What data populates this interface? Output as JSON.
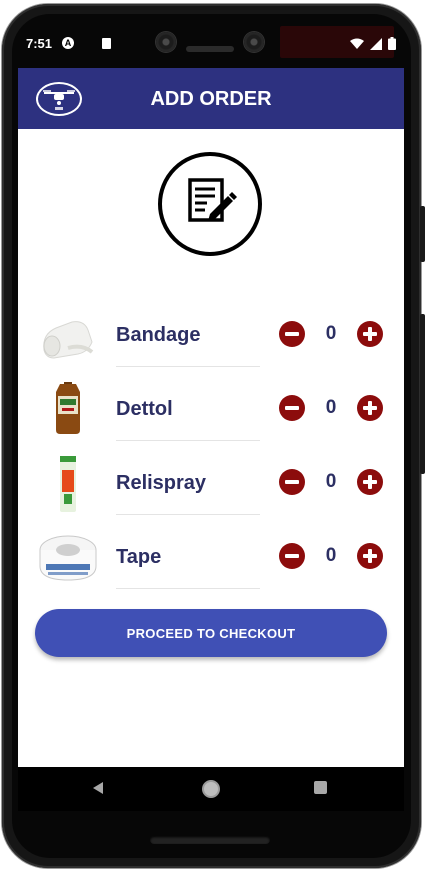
{
  "status_bar": {
    "time": "7:51"
  },
  "app_bar": {
    "title": "ADD ORDER"
  },
  "items": [
    {
      "name": "Bandage",
      "quantity": "0"
    },
    {
      "name": "Dettol",
      "quantity": "0"
    },
    {
      "name": "Relispray",
      "quantity": "0"
    },
    {
      "name": "Tape",
      "quantity": "0"
    }
  ],
  "checkout": {
    "label": "PROCEED TO CHECKOUT"
  },
  "colors": {
    "app_bar": "#2d3180",
    "button": "#4050b5",
    "qty_buttons": "#8c0c0c",
    "text": "#2c2f63"
  }
}
